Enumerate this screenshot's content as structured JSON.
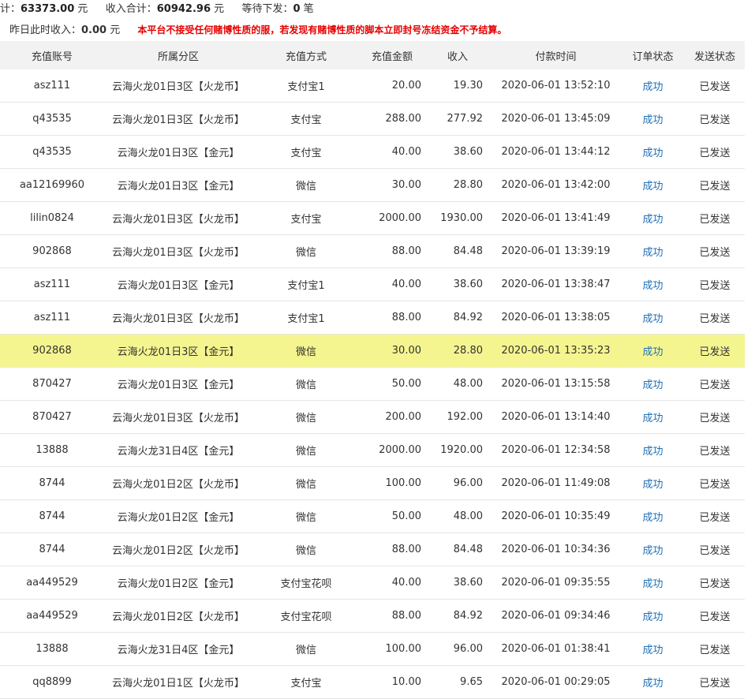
{
  "summary": {
    "total_label": "计：",
    "total_value": "63373.00",
    "unit": "元",
    "income_label": "收入合计：",
    "income_value": "60942.96",
    "pending_label": "等待下发：",
    "pending_value": "0",
    "pending_unit": "笔",
    "yesterday_label": "昨日此时收入：",
    "yesterday_value": "0.00",
    "warning": "本平台不接受任何赌博性质的服，若发现有赌博性质的脚本立即封号冻结资金不予结算。"
  },
  "table": {
    "headers": [
      "充值账号",
      "所属分区",
      "充值方式",
      "充值金额",
      "收入",
      "付款时间",
      "订单状态",
      "发送状态"
    ],
    "rows": [
      [
        "asz111",
        "云海火龙01日3区【火龙币】",
        "支付宝1",
        "20.00",
        "19.30",
        "2020-06-01 13:52:10",
        "成功",
        "已发送"
      ],
      [
        "q43535",
        "云海火龙01日3区【火龙币】",
        "支付宝",
        "288.00",
        "277.92",
        "2020-06-01 13:45:09",
        "成功",
        "已发送"
      ],
      [
        "q43535",
        "云海火龙01日3区【金元】",
        "支付宝",
        "40.00",
        "38.60",
        "2020-06-01 13:44:12",
        "成功",
        "已发送"
      ],
      [
        "aa12169960",
        "云海火龙01日3区【金元】",
        "微信",
        "30.00",
        "28.80",
        "2020-06-01 13:42:00",
        "成功",
        "已发送"
      ],
      [
        "lilin0824",
        "云海火龙01日3区【火龙币】",
        "支付宝",
        "2000.00",
        "1930.00",
        "2020-06-01 13:41:49",
        "成功",
        "已发送"
      ],
      [
        "902868",
        "云海火龙01日3区【火龙币】",
        "微信",
        "88.00",
        "84.48",
        "2020-06-01 13:39:19",
        "成功",
        "已发送"
      ],
      [
        "asz111",
        "云海火龙01日3区【金元】",
        "支付宝1",
        "40.00",
        "38.60",
        "2020-06-01 13:38:47",
        "成功",
        "已发送"
      ],
      [
        "asz111",
        "云海火龙01日3区【火龙币】",
        "支付宝1",
        "88.00",
        "84.92",
        "2020-06-01 13:38:05",
        "成功",
        "已发送"
      ],
      [
        "902868",
        "云海火龙01日3区【金元】",
        "微信",
        "30.00",
        "28.80",
        "2020-06-01 13:35:23",
        "成功",
        "已发送"
      ],
      [
        "870427",
        "云海火龙01日3区【金元】",
        "微信",
        "50.00",
        "48.00",
        "2020-06-01 13:15:58",
        "成功",
        "已发送"
      ],
      [
        "870427",
        "云海火龙01日3区【火龙币】",
        "微信",
        "200.00",
        "192.00",
        "2020-06-01 13:14:40",
        "成功",
        "已发送"
      ],
      [
        "13888",
        "云海火龙31日4区【金元】",
        "微信",
        "2000.00",
        "1920.00",
        "2020-06-01 12:34:58",
        "成功",
        "已发送"
      ],
      [
        "8744",
        "云海火龙01日2区【火龙币】",
        "微信",
        "100.00",
        "96.00",
        "2020-06-01 11:49:08",
        "成功",
        "已发送"
      ],
      [
        "8744",
        "云海火龙01日2区【金元】",
        "微信",
        "50.00",
        "48.00",
        "2020-06-01 10:35:49",
        "成功",
        "已发送"
      ],
      [
        "8744",
        "云海火龙01日2区【火龙币】",
        "微信",
        "88.00",
        "84.48",
        "2020-06-01 10:34:36",
        "成功",
        "已发送"
      ],
      [
        "aa449529",
        "云海火龙01日2区【金元】",
        "支付宝花呗",
        "40.00",
        "38.60",
        "2020-06-01 09:35:55",
        "成功",
        "已发送"
      ],
      [
        "aa449529",
        "云海火龙01日2区【火龙币】",
        "支付宝花呗",
        "88.00",
        "84.92",
        "2020-06-01 09:34:46",
        "成功",
        "已发送"
      ],
      [
        "13888",
        "云海火龙31日4区【金元】",
        "微信",
        "100.00",
        "96.00",
        "2020-06-01 01:38:41",
        "成功",
        "已发送"
      ],
      [
        "qq8899",
        "云海火龙01日1区【火龙币】",
        "支付宝",
        "10.00",
        "9.65",
        "2020-06-01 00:29:05",
        "成功",
        "已发送"
      ]
    ],
    "highlight_row_index": 8,
    "highlight_color": "#f5f590",
    "status_link_color": "#1f6fb5",
    "warning_color": "#e60000"
  }
}
